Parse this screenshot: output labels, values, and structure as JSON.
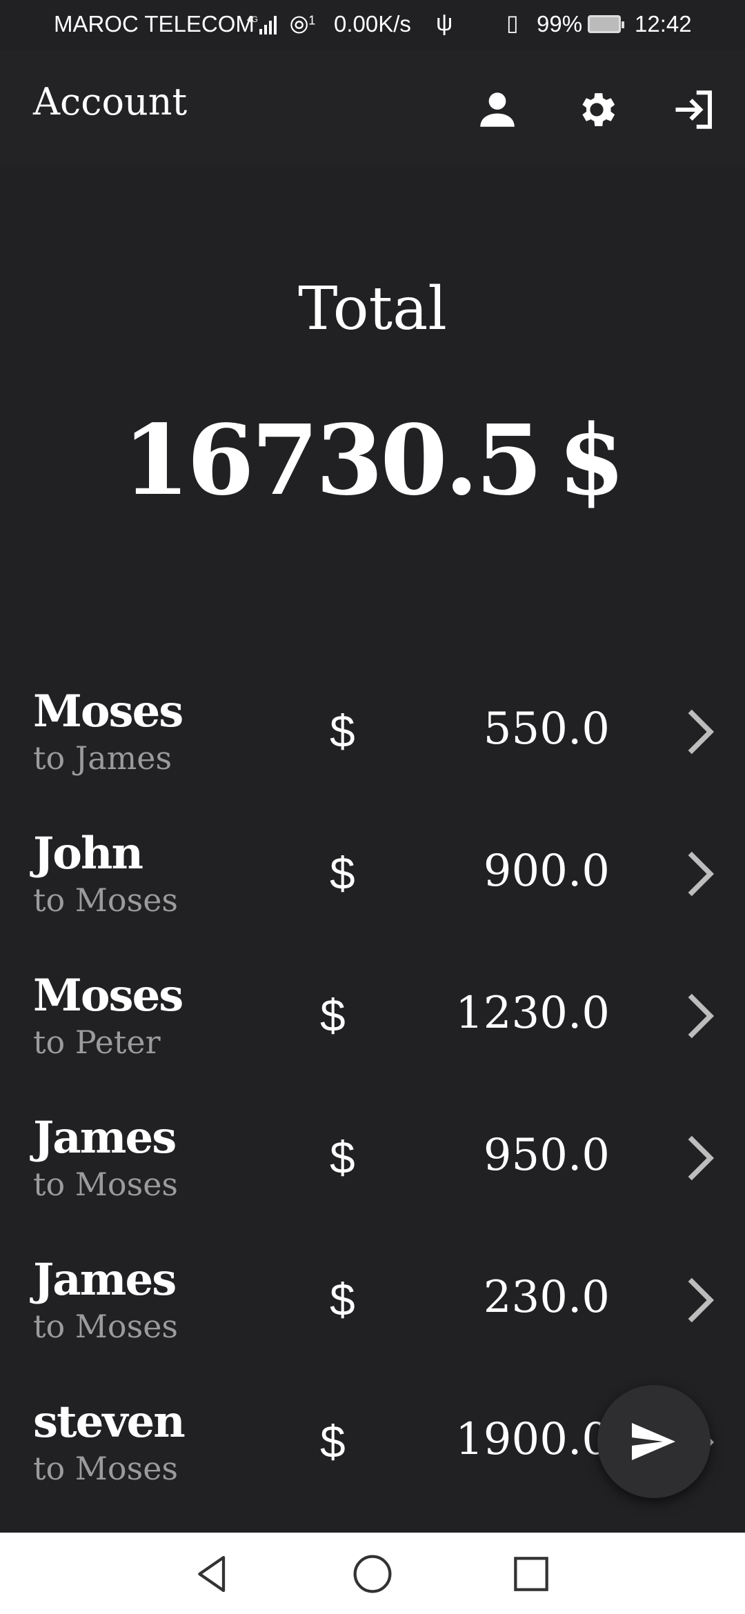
{
  "status_bar": {
    "carrier": "MAROC TELECOM",
    "network_type": "4G",
    "hotspot_count": "1",
    "speed": "0.00K/s",
    "battery": "99%",
    "time": "12:42",
    "icons": [
      "signal-icon",
      "hotspot-icon",
      "usb-icon",
      "vibrate-icon",
      "battery-icon"
    ]
  },
  "app_bar": {
    "title": "Account",
    "icons": [
      "profile-icon",
      "settings-icon",
      "login-icon"
    ]
  },
  "summary": {
    "label": "Total",
    "amount": "16730.5",
    "currency": "$"
  },
  "transactions": [
    {
      "from": "Moses",
      "to": "to James",
      "currency": "$",
      "amount": "550.0"
    },
    {
      "from": "John",
      "to": "to Moses",
      "currency": "$",
      "amount": "900.0"
    },
    {
      "from": "Moses",
      "to": "to Peter",
      "currency": "$",
      "amount": "1230.0"
    },
    {
      "from": "James",
      "to": "to Moses",
      "currency": "$",
      "amount": "950.0"
    },
    {
      "from": "James",
      "to": "to Moses",
      "currency": "$",
      "amount": "230.0"
    },
    {
      "from": "steven",
      "to": "to Moses",
      "currency": "$",
      "amount": "1900.0"
    }
  ],
  "fab": {
    "icon": "send-icon"
  },
  "nav_bar": {
    "icons": [
      "back-icon",
      "home-icon",
      "recents-icon"
    ]
  },
  "colors": {
    "background": "#212124",
    "app_bar": "#232326",
    "secondary_text": "#9b9b9e",
    "fab": "#2e2e30",
    "nav_bar": "#ffffff"
  }
}
